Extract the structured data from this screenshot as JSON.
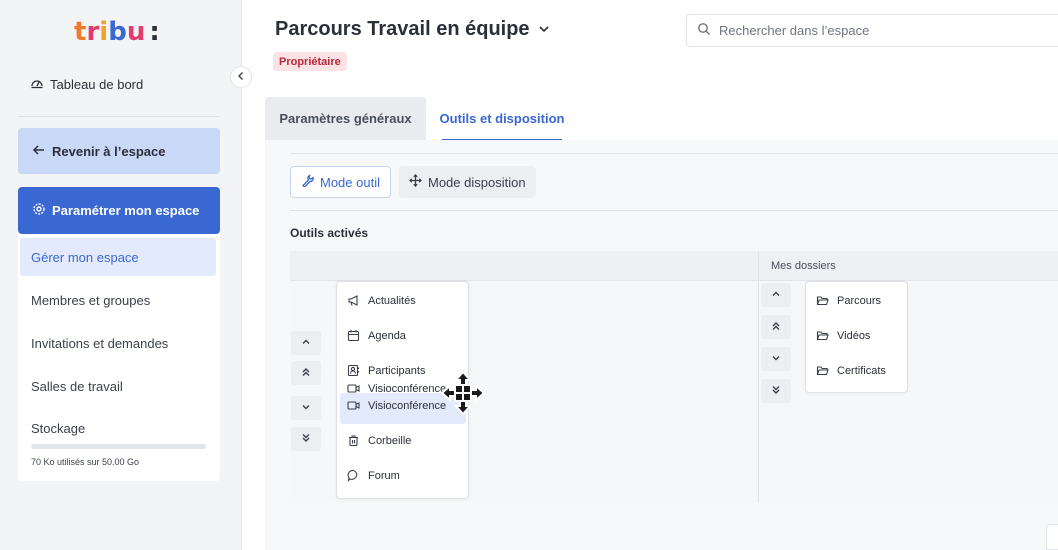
{
  "sidebar": {
    "logo_text": "tribu:",
    "dashboard_label": "Tableau de bord",
    "back_label": "Revenir à l’espace",
    "config_label": "Paramétrer mon espace",
    "menu": [
      {
        "label": "Gérer mon espace",
        "active": true
      },
      {
        "label": "Membres et groupes"
      },
      {
        "label": "Invitations et demandes"
      },
      {
        "label": "Salles de travail"
      },
      {
        "label": "Stockage"
      }
    ],
    "storage": {
      "used_text": "70 Ko utilisés sur 50.00 Go",
      "fill_fraction": 0.0
    }
  },
  "header": {
    "title": "Parcours Travail en équipe",
    "badge": "Propriétaire",
    "search_placeholder": "Rechercher dans l’espace"
  },
  "tabs": [
    {
      "label": "Paramètres généraux"
    },
    {
      "label": "Outils et disposition",
      "active": true
    }
  ],
  "toolbar": {
    "mode_outil": "Mode outil",
    "mode_disposition": "Mode disposition"
  },
  "section": {
    "title": "Outils activés",
    "right_column_title": "Mes dossiers"
  },
  "tools": [
    {
      "label": "Actualités",
      "icon": "megaphone-icon"
    },
    {
      "label": "Agenda",
      "icon": "calendar-icon"
    },
    {
      "label": "Participants",
      "icon": "contacts-icon"
    },
    {
      "label": "Visioconférence",
      "icon": "video-icon"
    },
    {
      "label": "Visioconférence",
      "icon": "video-icon"
    },
    {
      "label": "Corbeille",
      "icon": "trash-icon"
    },
    {
      "label": "Forum",
      "icon": "chat-icon"
    }
  ],
  "folders": [
    {
      "label": "Parcours",
      "icon": "folder-icon"
    },
    {
      "label": "Vidéos",
      "icon": "folder-icon"
    },
    {
      "label": "Certificats",
      "icon": "folder-icon"
    }
  ],
  "colors": {
    "accent": "#3a68d3",
    "badge_bg": "#fbe2e5",
    "badge_fg": "#b8283b"
  }
}
